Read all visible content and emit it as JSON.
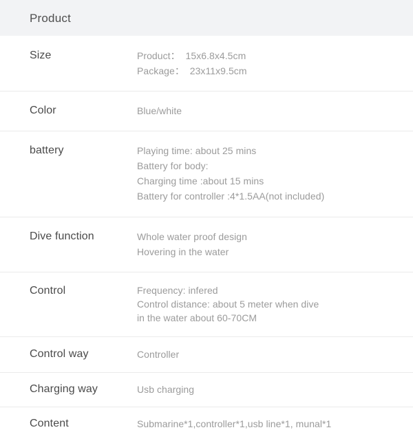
{
  "header": {
    "title": "Product",
    "background_color": "#f2f3f5"
  },
  "colors": {
    "page_background": "#ffffff",
    "header_background": "#f2f3f5",
    "label_text": "#4a4a4a",
    "value_text": "#9b9b9b",
    "separator": "#ebebeb"
  },
  "table": {
    "rows": [
      {
        "label": "Size",
        "lines": [
          "Product：  15x6.8x4.5cm",
          "Package：  23x11x9.5cm"
        ]
      },
      {
        "label": "Color",
        "lines": [
          "Blue/white"
        ]
      },
      {
        "label": "battery",
        "lines": [
          "Playing time: about 25 mins",
          "Battery for body:",
          "Charging time :about 15 mins",
          "Battery for controller :4*1.5AA(not included)"
        ]
      },
      {
        "label": "Dive function",
        "lines": [
          "Whole water proof design",
          "Hovering in the water"
        ]
      },
      {
        "label": "Control",
        "lines": [
          "Frequency: infered",
          "Control distance: about 5 meter when dive",
          "in the water about 60-70CM"
        ]
      },
      {
        "label": "Control way",
        "lines": [
          "Controller"
        ]
      },
      {
        "label": "Charging way",
        "lines": [
          "Usb charging"
        ]
      },
      {
        "label": "Content",
        "lines": [
          "Submarine*1,controller*1,usb line*1, munal*1"
        ]
      }
    ]
  }
}
